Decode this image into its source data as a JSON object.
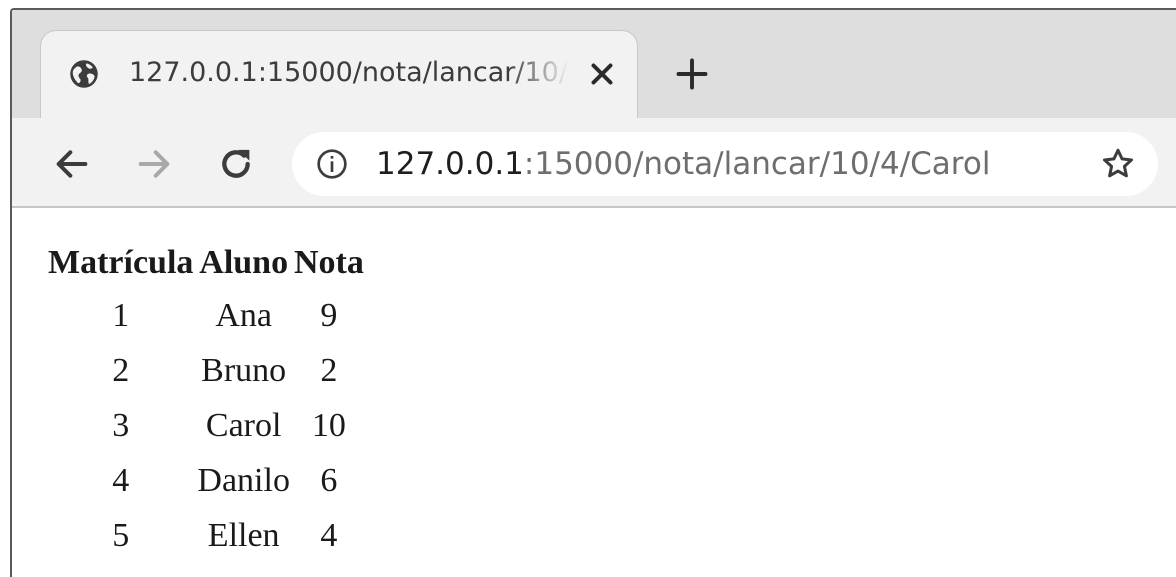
{
  "browser": {
    "tab": {
      "title": "127.0.0.1:15000/nota/lancar/10/4/Carol",
      "favicon": "globe-icon",
      "close_icon": "close-icon"
    },
    "new_tab_icon": "plus-icon",
    "nav": {
      "back_icon": "back-arrow-icon",
      "forward_icon": "forward-arrow-icon",
      "reload_icon": "reload-icon"
    },
    "address_bar": {
      "info_icon": "info-icon",
      "host": "127.0.0.1",
      "path": ":15000/nota/lancar/10/4/Carol",
      "bookmark_icon": "star-icon"
    }
  },
  "page": {
    "table": {
      "headers": [
        "Matrícula",
        "Aluno",
        "Nota"
      ],
      "rows": [
        [
          "1",
          "Ana",
          "9"
        ],
        [
          "2",
          "Bruno",
          "2"
        ],
        [
          "3",
          "Carol",
          "10"
        ],
        [
          "4",
          "Danilo",
          "6"
        ],
        [
          "5",
          "Ellen",
          "4"
        ]
      ]
    }
  },
  "colors": {
    "tabstrip_bg": "#dedede",
    "toolbar_bg": "#f2f2f2",
    "icon": "#3c3c3c",
    "icon_disabled": "#a8a8a8",
    "url_host": "#1e1e1e",
    "url_path": "#6e6e6e"
  }
}
